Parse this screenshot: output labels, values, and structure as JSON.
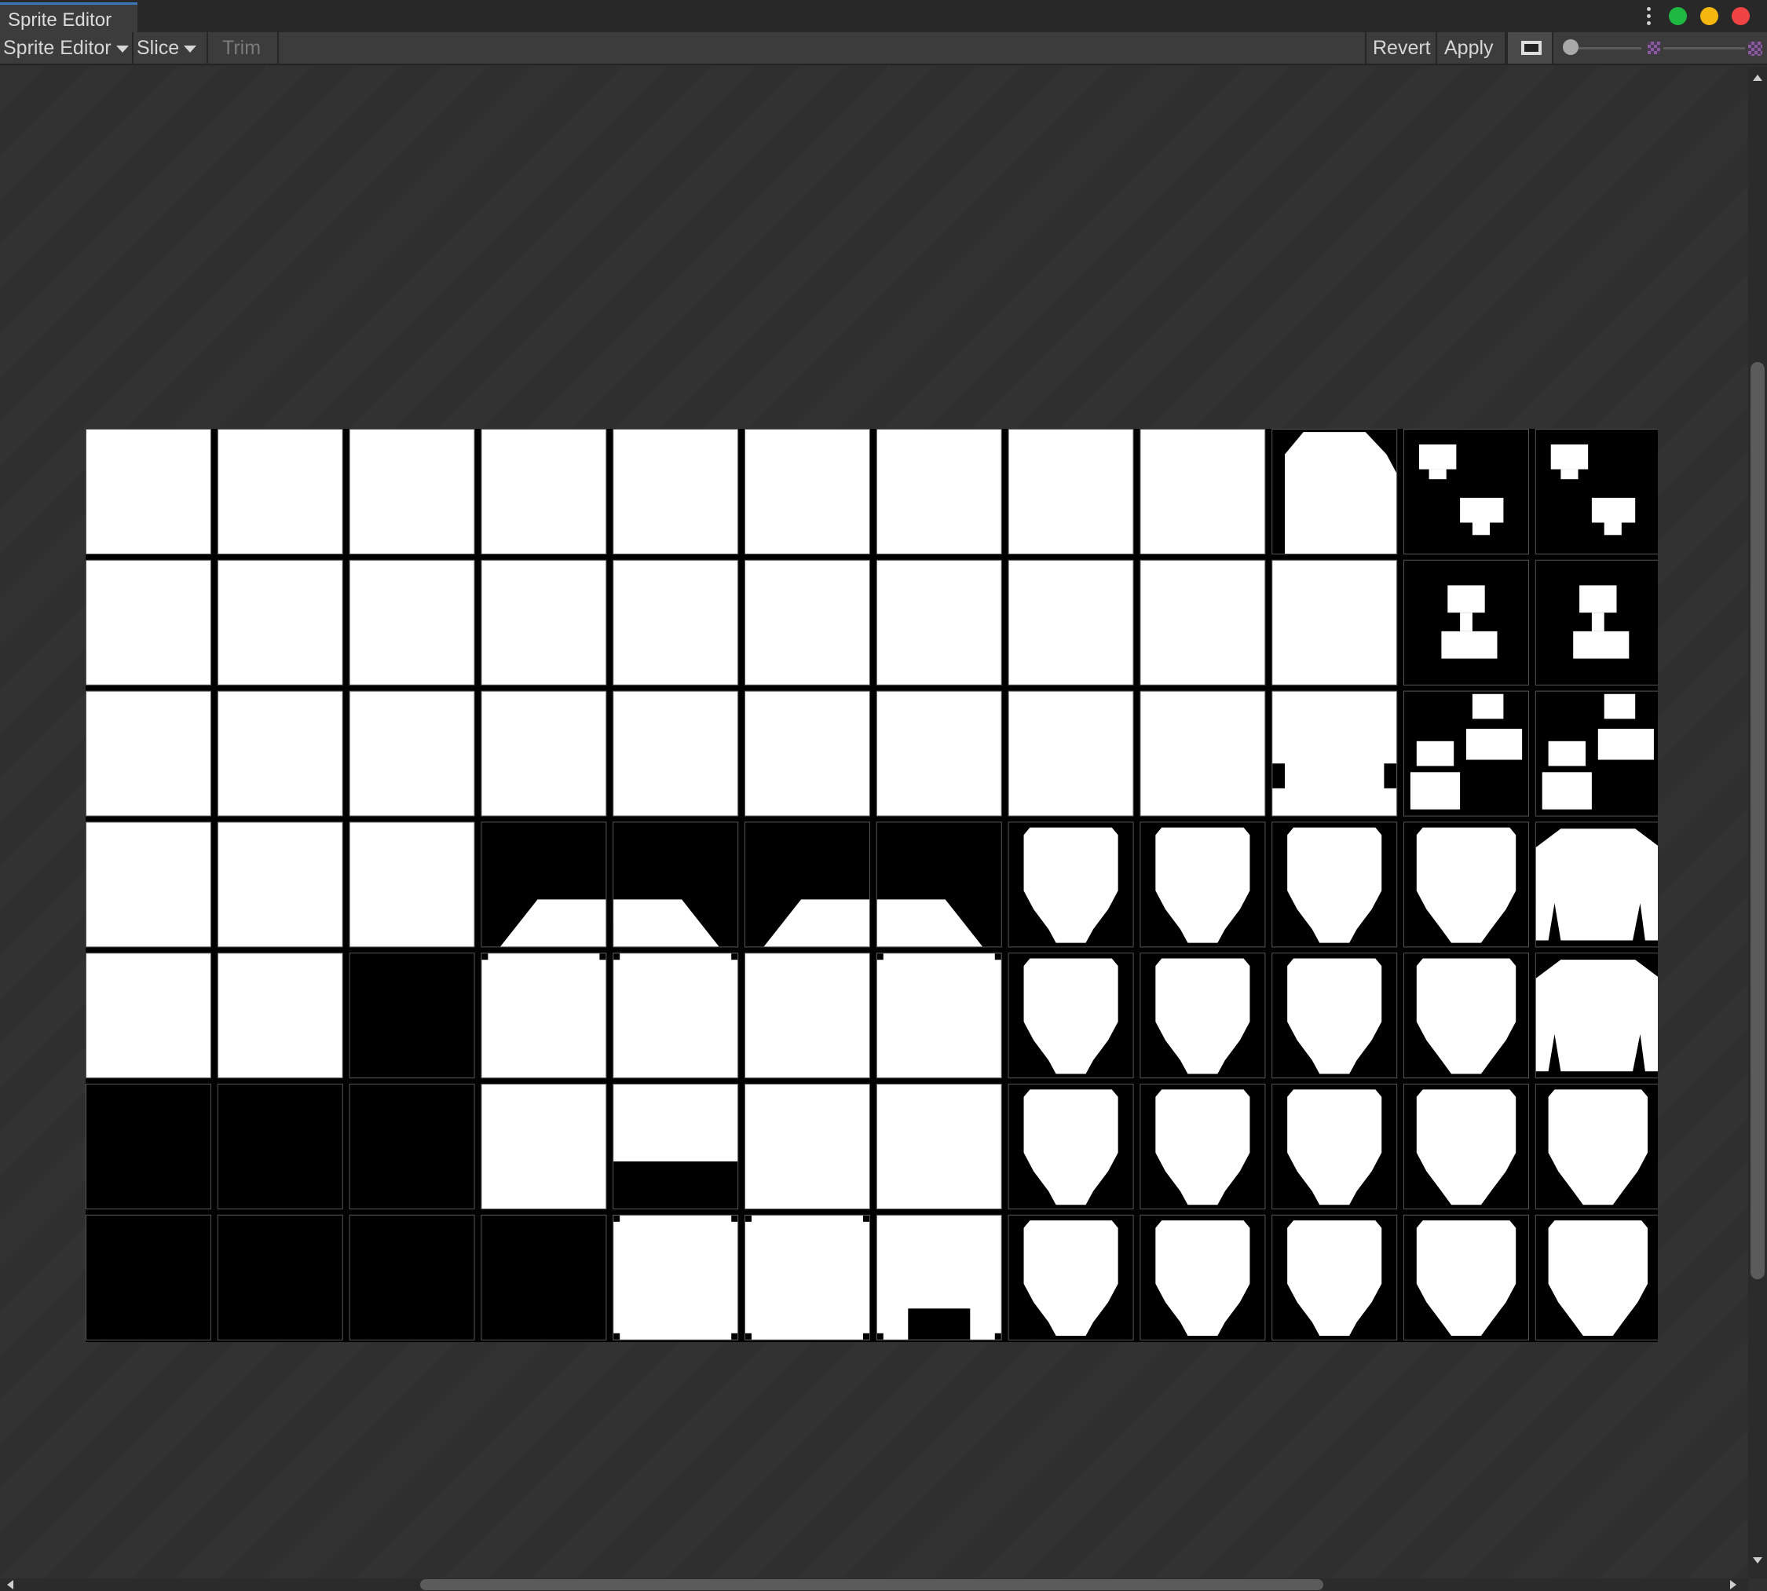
{
  "window": {
    "tab_title": "Sprite Editor",
    "traffic_lights": [
      "#1fb842",
      "#f5b60f",
      "#ef4443"
    ]
  },
  "toolbar": {
    "editor_mode": "Sprite Editor",
    "slice": "Slice",
    "trim": "Trim",
    "revert": "Revert",
    "apply": "Apply",
    "zoom_level": 0.0,
    "mip_level": 0.0
  },
  "sprite_sheet": {
    "columns": 12,
    "rows": 7,
    "row_patterns": [
      [
        "white",
        "white",
        "white",
        "white",
        "white",
        "white",
        "white",
        "white",
        "white",
        "dome",
        "cross2",
        "cross2b"
      ],
      [
        "white",
        "white",
        "white",
        "white",
        "white",
        "white",
        "white",
        "white",
        "white",
        "white",
        "flower",
        "flower"
      ],
      [
        "white",
        "white",
        "white",
        "white",
        "white",
        "white",
        "white",
        "white",
        "white",
        "notched",
        "flowers2",
        "flowers2b"
      ],
      [
        "white",
        "white",
        "white",
        "slopeL",
        "slopeR",
        "slopeL",
        "slopeR",
        "balloon",
        "balloon",
        "balloon",
        "balloonWide",
        "bigBalloon"
      ],
      [
        "white",
        "white",
        "empty",
        "cornersTL",
        "cornersTR",
        "white",
        "cornersTR",
        "balloon",
        "balloon",
        "balloon",
        "balloonWide",
        "bigBalloon"
      ],
      [
        "empty",
        "empty",
        "empty",
        "white",
        "halfBar",
        "white",
        "white",
        "balloon",
        "balloon",
        "balloon",
        "balloonWide",
        "balloonWide"
      ],
      [
        "empty",
        "empty",
        "empty",
        "empty",
        "cornersAll",
        "cornersAll",
        "doorway",
        "balloon",
        "balloon",
        "balloon",
        "balloonWide",
        "balloonWide"
      ]
    ]
  },
  "colors": {
    "panel_bg": "#303030",
    "toolbar_bg": "#3c3c3c",
    "tab_accent": "#3a79bb",
    "sprite_fill": "#ffffff",
    "sprite_bg": "#000000"
  }
}
